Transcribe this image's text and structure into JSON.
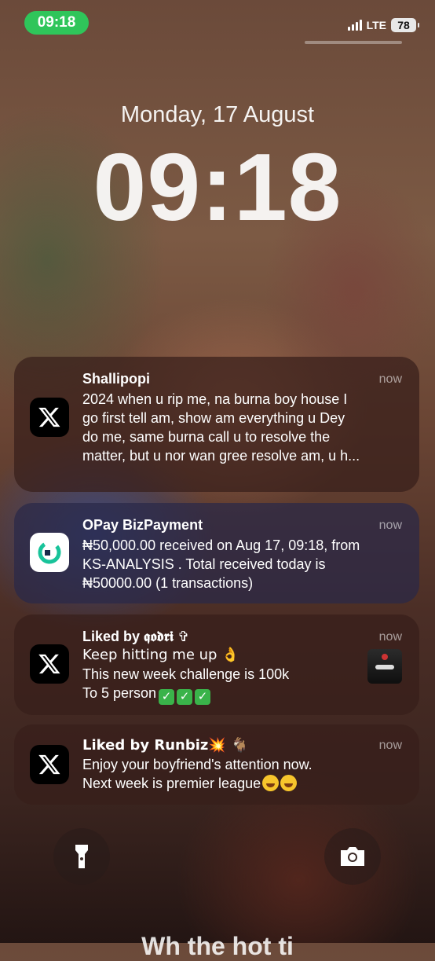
{
  "status_bar": {
    "time": "09:18",
    "network": "LTE",
    "battery": "78",
    "icons": [
      "signal-icon",
      "battery-icon"
    ]
  },
  "lockscreen": {
    "date": "Monday, 17 August",
    "time": "09:18"
  },
  "notifications": [
    {
      "app_icon": "x-app-icon",
      "title": "Shallipopi",
      "time": "now",
      "body": [
        "2024 when u rip me, na burna boy house I",
        "go first tell am, show am everything u Dey",
        "do me, same burna call u to resolve the",
        "matter, but u nor wan gree resolve am, u h..."
      ]
    },
    {
      "app_icon": "opay-app-icon",
      "title": "OPay BizPayment",
      "time": "now",
      "body": [
        "₦50,000.00 received on Aug 17, 09:18, from",
        "KS-ANALYSIS . Total received today is",
        "₦50000.00 (1 transactions)"
      ]
    },
    {
      "app_icon": "x-app-icon",
      "title": "Liked by 𝖖𝖔𝖉𝖗𝖎 ✞",
      "time": "now",
      "body": [
        "Keep hitting me up 👌",
        "This new week challenge is 100k",
        "To 5 person"
      ]
    },
    {
      "app_icon": "x-app-icon",
      "title": "Liked by Runbiz💥 🐐",
      "time": "now",
      "body": [
        "Enjoy your boyfriend's attention now.",
        "Next week is premier league"
      ]
    }
  ],
  "bottom": {
    "flashlight_icon": "flashlight-icon",
    "camera_icon": "camera-icon",
    "partial_text": "Wh the hot ti"
  },
  "colors": {
    "time_pill": "#2fc55a",
    "notification_bg": "#371a16"
  }
}
